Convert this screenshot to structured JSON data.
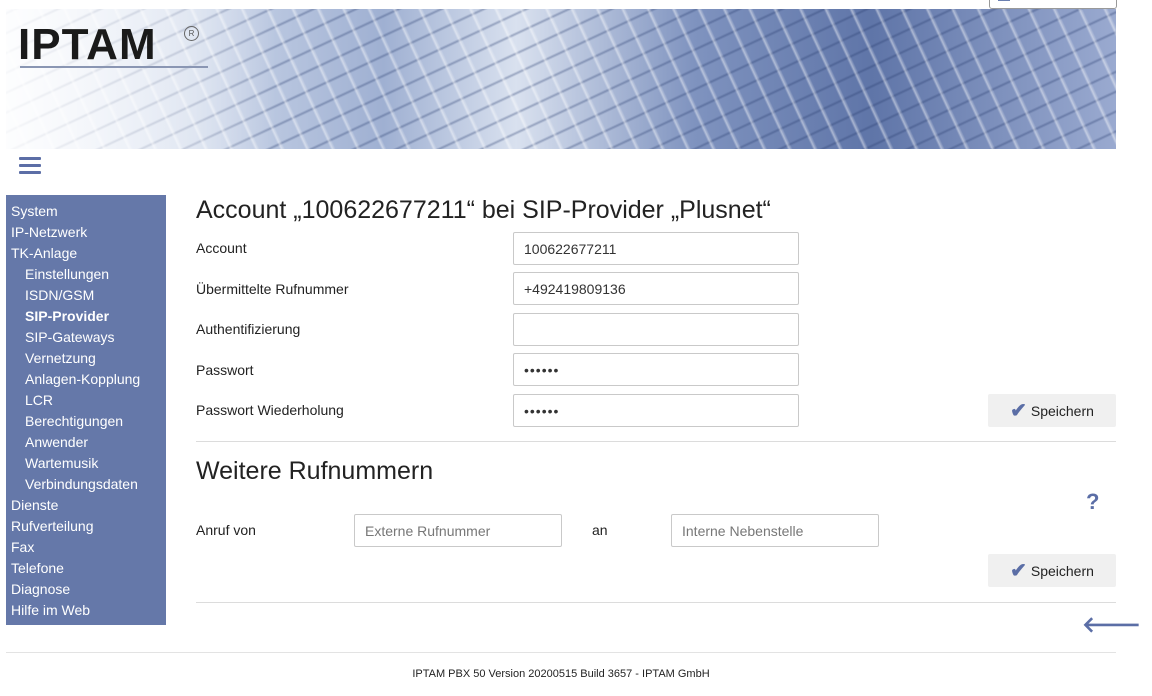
{
  "header": {
    "logo_text": "IPTAM",
    "logo_reg": "R"
  },
  "sidebar": {
    "items": [
      {
        "label": "System"
      },
      {
        "label": "IP-Netzwerk"
      },
      {
        "label": "TK-Anlage"
      },
      {
        "label": "Einstellungen"
      },
      {
        "label": "ISDN/GSM"
      },
      {
        "label": "SIP-Provider"
      },
      {
        "label": "SIP-Gateways"
      },
      {
        "label": "Vernetzung"
      },
      {
        "label": "Anlagen-Kopplung"
      },
      {
        "label": "LCR"
      },
      {
        "label": "Berechtigungen"
      },
      {
        "label": "Anwender"
      },
      {
        "label": "Wartemusik"
      },
      {
        "label": "Verbindungsdaten"
      },
      {
        "label": "Dienste"
      },
      {
        "label": "Rufverteilung"
      },
      {
        "label": "Fax"
      },
      {
        "label": "Telefone"
      },
      {
        "label": "Diagnose"
      },
      {
        "label": "Hilfe im Web"
      }
    ]
  },
  "account": {
    "title": "Account „100622677211“ bei SIP-Provider „Plusnet“",
    "fields": {
      "account": {
        "label": "Account",
        "value": "100622677211"
      },
      "number": {
        "label": "Übermittelte Rufnummer",
        "value": "+492419809136"
      },
      "auth": {
        "label": "Authentifizierung",
        "value": ""
      },
      "password": {
        "label": "Passwort",
        "value": "••••••"
      },
      "password_repeat": {
        "label": "Passwort Wiederholung",
        "value": "••••••"
      }
    },
    "save_label": "Speichern"
  },
  "more_numbers": {
    "title": "Weitere Rufnummern",
    "call_from_label": "Anruf von",
    "external_placeholder": "Externe Rufnummer",
    "to_label": "an",
    "internal_placeholder": "Interne Nebenstelle",
    "save_label": "Speichern",
    "help_glyph": "?"
  },
  "icons": {
    "check": "check-icon",
    "back": "arrow-left-icon",
    "menu": "hamburger-icon",
    "help": "question-icon"
  },
  "colors": {
    "accent": "#5b6ea6",
    "sidebar": "#6578a9"
  },
  "footer": {
    "text": "IPTAM PBX 50 Version 20200515 Build 3657 - IPTAM GmbH"
  }
}
